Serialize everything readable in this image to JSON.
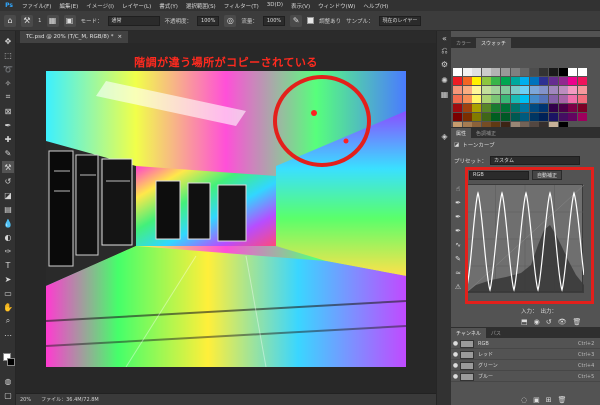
{
  "menu": {
    "logo": "Ps",
    "items": [
      "ファイル(F)",
      "編集(E)",
      "イメージ(I)",
      "レイヤー(L)",
      "書式(Y)",
      "選択範囲(S)",
      "フィルター(T)",
      "3D(D)",
      "表示(V)",
      "ウィンドウ(W)",
      "ヘルプ(H)"
    ]
  },
  "options": {
    "brush_size": "1",
    "mode_label": "モード：",
    "mode_value": "通常",
    "opacity_label": "不透明度：",
    "opacity_value": "100%",
    "flow_label": "流量：",
    "flow_value": "100%",
    "aligned_label": "調整あり",
    "sample_label": "サンプル：",
    "sample_value": "現在のレイヤー"
  },
  "document": {
    "tab_title": "TC.psd @ 20% (T/C_M, RGB/8) *",
    "close": "×",
    "annotation": "階調が違う場所がコピーされている"
  },
  "status": {
    "zoom": "20%",
    "file_info": "ファイル：36.4M/72.8M"
  },
  "swatches_panel": {
    "tabs": [
      "カラー",
      "スウォッチ"
    ],
    "row_gray": [
      "#ffffff",
      "#f2f2f2",
      "#e0e0e0",
      "#cccccc",
      "#b3b3b3",
      "#999999",
      "#808080",
      "#666666",
      "#4d4d4d",
      "#333333",
      "#1a1a1a",
      "#000000",
      "#ffffff",
      "#ffffff"
    ],
    "row_bright": [
      "#ed1c24",
      "#f26522",
      "#fff200",
      "#8dc63f",
      "#39b54a",
      "#00a651",
      "#00a99d",
      "#00aeef",
      "#0072bc",
      "#2e3192",
      "#662d91",
      "#92278f",
      "#ec008c",
      "#ed145b"
    ],
    "row_light": [
      "#f69679",
      "#f9ad81",
      "#fff799",
      "#c4df9b",
      "#a3d39c",
      "#82ca9c",
      "#7accc8",
      "#6dcff6",
      "#7da7d9",
      "#8393ca",
      "#a187be",
      "#bd8cbf",
      "#f49ac1",
      "#f5989d"
    ],
    "row_mid": [
      "#f26c4f",
      "#f68e56",
      "#fff568",
      "#acd372",
      "#7cc576",
      "#3bb878",
      "#1abbb4",
      "#00bff3",
      "#448ccb",
      "#5574b9",
      "#8560a8",
      "#a864a8",
      "#f06eaa",
      "#f26d7d"
    ],
    "row_dark": [
      "#9e0b0f",
      "#a0410d",
      "#aba000",
      "#598527",
      "#197b30",
      "#007236",
      "#00746b",
      "#0076a3",
      "#004a80",
      "#003471",
      "#32004b",
      "#4b0049",
      "#7b0046",
      "#7a0026"
    ],
    "row_deep": [
      "#790000",
      "#7b2e00",
      "#827b00",
      "#406618",
      "#005e20",
      "#005826",
      "#005952",
      "#005b7f",
      "#003663",
      "#002157",
      "#1b1464",
      "#440e62",
      "#630460",
      "#9e005d"
    ],
    "row_brown": [
      "#c69c6d",
      "#a67c52",
      "#8c6239",
      "#754c24",
      "#603913",
      "#3c2415",
      "#998675",
      "#736357",
      "#534741",
      "#362f2d",
      "#c7b299",
      "#000000"
    ]
  },
  "properties_panel": {
    "tabs": [
      "属性",
      "色調補正"
    ],
    "layer_type": "トーンカーブ",
    "preset_label": "プリセット：",
    "preset_value": "カスタム",
    "channel_value": "RGB",
    "auto_button": "自動補正",
    "input_label": "入力：",
    "output_label": "出力："
  },
  "channels_panel": {
    "tabs": [
      "チャンネル",
      "パス"
    ],
    "rows": [
      {
        "name": "RGB",
        "shortcut": "Ctrl+2"
      },
      {
        "name": "レッド",
        "shortcut": "Ctrl+3"
      },
      {
        "name": "グリーン",
        "shortcut": "Ctrl+4"
      },
      {
        "name": "ブルー",
        "shortcut": "Ctrl+5"
      }
    ]
  },
  "colors": {
    "annotation_red": "#ff2a1f",
    "highlight_red": "#e3201b",
    "fg": "#ffffff",
    "bg": "#000000"
  }
}
